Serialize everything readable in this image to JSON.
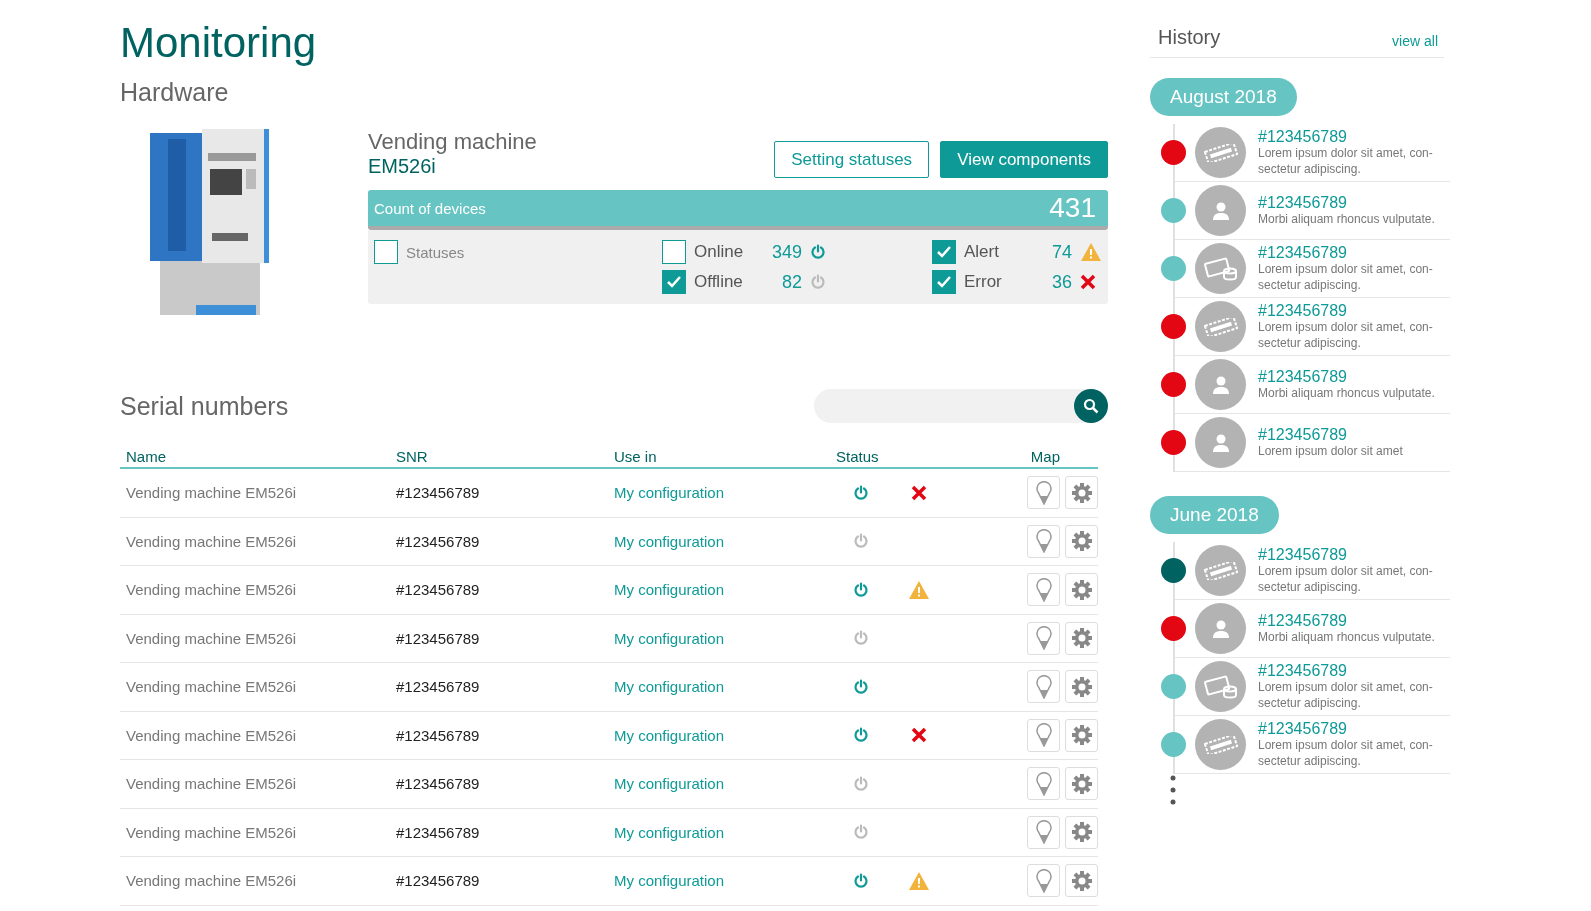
{
  "title": "Monitoring",
  "subtitle": "Hardware",
  "device": {
    "name": "Vending machine",
    "model": "EM526i",
    "buttons": [
      {
        "label": "Setting statuses",
        "kind": "outline"
      },
      {
        "label": "View components",
        "kind": "solid"
      }
    ],
    "count": {
      "label": "Count of devices",
      "value": "431"
    },
    "filters": [
      {
        "label": "Statuses",
        "checked": false,
        "kind": "plain"
      },
      {
        "label": "Online",
        "checked": false,
        "kind": "online",
        "count": "349"
      },
      {
        "label": "Offline",
        "checked": true,
        "kind": "offline",
        "count": "82"
      },
      {
        "label": "Alert",
        "checked": true,
        "kind": "alert",
        "count": "74"
      },
      {
        "label": "Error",
        "checked": true,
        "kind": "error",
        "count": "36"
      }
    ]
  },
  "serials": {
    "title": "Serial numbers",
    "columns": [
      "Name",
      "SNR",
      "Use in",
      "Status",
      "Map"
    ],
    "rows": [
      {
        "name": "Vending machine EM526i",
        "snr": "#123456789",
        "use_in": "My configuration",
        "online": true,
        "error": true,
        "alert": false
      },
      {
        "name": "Vending machine EM526i",
        "snr": "#123456789",
        "use_in": "My configuration",
        "online": false,
        "error": false,
        "alert": false
      },
      {
        "name": "Vending machine EM526i",
        "snr": "#123456789",
        "use_in": "My configuration",
        "online": true,
        "error": false,
        "alert": true
      },
      {
        "name": "Vending machine EM526i",
        "snr": "#123456789",
        "use_in": "My configuration",
        "online": false,
        "error": false,
        "alert": false
      },
      {
        "name": "Vending machine EM526i",
        "snr": "#123456789",
        "use_in": "My configuration",
        "online": true,
        "error": false,
        "alert": false
      },
      {
        "name": "Vending machine EM526i",
        "snr": "#123456789",
        "use_in": "My configuration",
        "online": true,
        "error": true,
        "alert": false
      },
      {
        "name": "Vending machine EM526i",
        "snr": "#123456789",
        "use_in": "My configuration",
        "online": false,
        "error": false,
        "alert": false
      },
      {
        "name": "Vending machine EM526i",
        "snr": "#123456789",
        "use_in": "My configuration",
        "online": false,
        "error": false,
        "alert": false
      },
      {
        "name": "Vending machine EM526i",
        "snr": "#123456789",
        "use_in": "My configuration",
        "online": true,
        "error": false,
        "alert": true
      }
    ]
  },
  "history": {
    "title": "History",
    "link": "view all",
    "groups": [
      {
        "label": "August 2018",
        "items": [
          {
            "id": "#123456789",
            "text": "Lorem ipsum dolor sit amet, con-sectetur adipiscing.",
            "kind": "ticket",
            "color": "#e30613"
          },
          {
            "id": "#123456789",
            "text": "Morbi aliquam rhoncus vulputate.",
            "kind": "person",
            "color": "#66c4c2"
          },
          {
            "id": "#123456789",
            "text": "Lorem ipsum dolor sit amet, con-sectetur adipiscing.",
            "kind": "money",
            "color": "#66c4c2"
          },
          {
            "id": "#123456789",
            "text": "Lorem ipsum dolor sit amet, con-sectetur adipiscing.",
            "kind": "ticket",
            "color": "#e30613"
          },
          {
            "id": "#123456789",
            "text": "Morbi aliquam rhoncus vulputate.",
            "kind": "person",
            "color": "#e30613"
          },
          {
            "id": "#123456789",
            "text": "Lorem ipsum dolor sit amet",
            "kind": "person",
            "color": "#e30613"
          }
        ]
      },
      {
        "label": "June 2018",
        "items": [
          {
            "id": "#123456789",
            "text": "Lorem ipsum dolor sit amet, con-sectetur adipiscing.",
            "kind": "ticket",
            "color": "#006361"
          },
          {
            "id": "#123456789",
            "text": "Morbi aliquam rhoncus vulputate.",
            "kind": "person",
            "color": "#e30613"
          },
          {
            "id": "#123456789",
            "text": "Lorem ipsum dolor sit amet, con-sectetur adipiscing.",
            "kind": "money",
            "color": "#66c4c2"
          },
          {
            "id": "#123456789",
            "text": "Lorem ipsum dolor sit amet, con-sectetur adipiscing.",
            "kind": "ticket",
            "color": "#66c4c2"
          }
        ]
      }
    ]
  }
}
